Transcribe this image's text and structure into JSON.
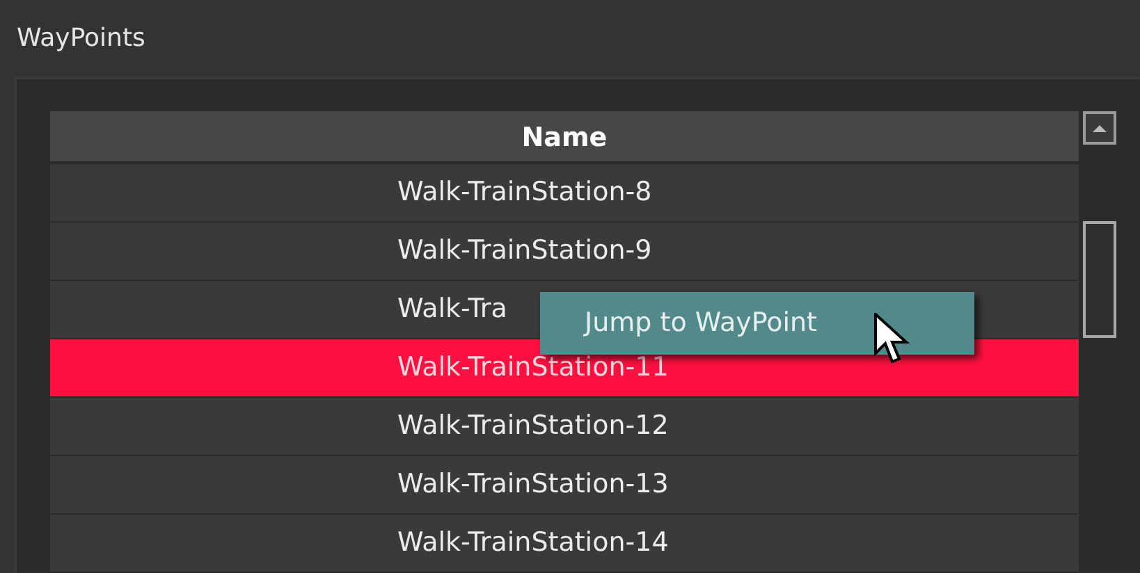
{
  "panel": {
    "title": "WayPoints"
  },
  "table": {
    "columns": [
      "Name"
    ],
    "rows": [
      {
        "name": "Walk-TrainStation-8",
        "selected": false
      },
      {
        "name": "Walk-TrainStation-9",
        "selected": false
      },
      {
        "name": "Walk-Tra",
        "selected": false
      },
      {
        "name": "Walk-TrainStation-11",
        "selected": true
      },
      {
        "name": "Walk-TrainStation-12",
        "selected": false
      },
      {
        "name": "Walk-TrainStation-13",
        "selected": false
      },
      {
        "name": "Walk-TrainStation-14",
        "selected": false
      }
    ]
  },
  "context_menu": {
    "items": [
      "Jump to WayPoint"
    ]
  }
}
